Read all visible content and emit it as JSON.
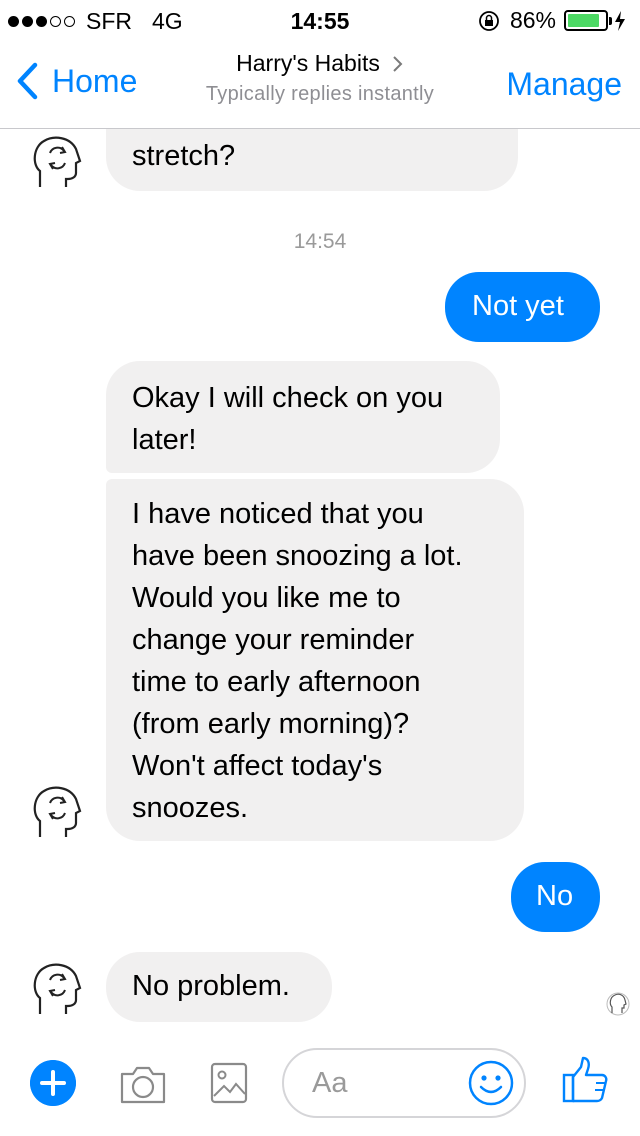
{
  "status_bar": {
    "carrier": "SFR",
    "network": "4G",
    "time": "14:55",
    "battery_percent": "86%",
    "battery_level": 0.86,
    "signal_bars_filled": 3,
    "signal_bars_total": 5,
    "icons": [
      "signal-dots-icon",
      "orientation-lock-icon",
      "battery-icon",
      "charging-bolt-icon"
    ]
  },
  "nav": {
    "back_label": "Home",
    "title": "Harry's Habits",
    "subtitle": "Typically replies instantly",
    "manage_label": "Manage"
  },
  "messages": {
    "clipped_text": "you completed your stretch",
    "m1": {
      "side": "incoming",
      "lines": [
        "stretch?"
      ]
    },
    "timestamp": "14:54",
    "m2": {
      "side": "outgoing",
      "lines": [
        "Not yet"
      ]
    },
    "m3": {
      "side": "incoming",
      "lines": [
        "Okay I will check on you",
        "later!"
      ]
    },
    "m4": {
      "side": "incoming",
      "lines": [
        "I have noticed that you",
        "have been snoozing a lot.",
        "Would you like me to",
        "change your reminder",
        "time to early afternoon",
        "(from early morning)?",
        "Won't affect today's",
        "snoozes."
      ]
    },
    "m5": {
      "side": "outgoing",
      "lines": [
        "No"
      ]
    },
    "m6": {
      "side": "incoming",
      "lines": [
        "No problem."
      ]
    }
  },
  "composer": {
    "placeholder": "Aa",
    "icons": [
      "plus-icon",
      "camera-icon",
      "gallery-icon",
      "emoji-icon",
      "thumbs-up-icon"
    ]
  },
  "colors": {
    "accent": "#0084ff",
    "incoming_bubble": "#f1f0f0",
    "battery_green": "#4cd964",
    "timestamp_gray": "#9a9a9a"
  }
}
